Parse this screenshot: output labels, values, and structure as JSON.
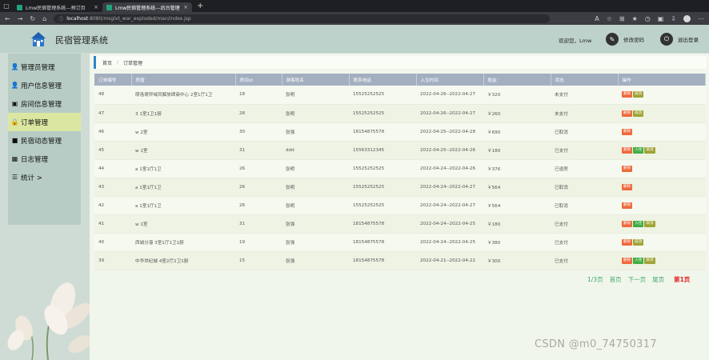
{
  "browser": {
    "tabs": [
      {
        "title": "Lmw民宿管理系统---预订页",
        "close": "×",
        "active": false
      },
      {
        "title": "Lmw民宿管理系统---后台管理",
        "close": "×",
        "active": true
      }
    ],
    "new_tab": "+",
    "url_host": "localhost",
    "url_rest": ":8080/msglxt_war_exploded/man/index.jsp"
  },
  "header": {
    "app_title": "民宿管理系统",
    "welcome": "欢迎您，Lmw",
    "change_password": "修改密码",
    "logout": "退出登录"
  },
  "sidebar": {
    "items": [
      {
        "label": "管理员管理",
        "icon": "👤"
      },
      {
        "label": "用户信息管理",
        "icon": "👤"
      },
      {
        "label": "房间信息管理",
        "icon": "▣"
      },
      {
        "label": "订单管理",
        "icon": "🔒",
        "active": true
      },
      {
        "label": "民宿动态管理",
        "icon": "■"
      },
      {
        "label": "日志管理",
        "icon": "▦"
      },
      {
        "label": "统计 >",
        "icon": "☰"
      }
    ]
  },
  "breadcrumb": {
    "home": "首页",
    "sep": "/",
    "current": "订单管理"
  },
  "table": {
    "columns": [
      "订单编号",
      "房屋",
      "房间id",
      "游客姓名",
      "联系电话",
      "入住时间",
      "租金",
      "状态",
      "操作"
    ],
    "rows": [
      {
        "id": "48",
        "room": "摩洛哥异域风解放碑商中心 2室1厅1卫",
        "room_id": "18",
        "guest": "张明",
        "phone": "15525252525",
        "dates": "2022-04-26--2022-04-27",
        "rent": "￥320",
        "status": "未支付",
        "actions": [
          "删除",
          "取消"
        ]
      },
      {
        "id": "47",
        "room": "3 1室1卫1厨",
        "room_id": "28",
        "guest": "张明",
        "phone": "15525252525",
        "dates": "2022-04-26--2022-04-27",
        "rent": "￥260",
        "status": "未支付",
        "actions": [
          "删除",
          "取消"
        ]
      },
      {
        "id": "46",
        "room": "w 2室",
        "room_id": "30",
        "guest": "张强",
        "phone": "18154875578",
        "dates": "2022-04-25--2022-04-28",
        "rent": "￥690",
        "status": "已取消",
        "actions": [
          "删除"
        ]
      },
      {
        "id": "45",
        "room": "w 1室",
        "room_id": "31",
        "guest": "ddd",
        "phone": "15563312345",
        "dates": "2022-04-25--2022-04-26",
        "rent": "￥180",
        "status": "已支付",
        "actions": [
          "删除",
          "入住",
          "取消"
        ]
      },
      {
        "id": "44",
        "room": "a 1室1厅1卫",
        "room_id": "26",
        "guest": "张明",
        "phone": "15525252525",
        "dates": "2022-04-24--2022-04-26",
        "rent": "￥376",
        "status": "已退房",
        "actions": [
          "删除"
        ]
      },
      {
        "id": "43",
        "room": "a 1室1厅1卫",
        "room_id": "26",
        "guest": "张明",
        "phone": "15525252525",
        "dates": "2022-04-24--2022-04-27",
        "rent": "￥564",
        "status": "已取消",
        "actions": [
          "删除"
        ]
      },
      {
        "id": "42",
        "room": "a 1室1厅1卫",
        "room_id": "26",
        "guest": "张明",
        "phone": "15525252525",
        "dates": "2022-04-24--2022-04-27",
        "rent": "￥564",
        "status": "已取消",
        "actions": [
          "删除"
        ]
      },
      {
        "id": "41",
        "room": "w 1室",
        "room_id": "31",
        "guest": "张强",
        "phone": "18154875578",
        "dates": "2022-04-24--2022-04-25",
        "rent": "￥180",
        "status": "已支付",
        "actions": [
          "删除",
          "入住",
          "取消"
        ]
      },
      {
        "id": "40",
        "room": "西城分港 3室1厅1卫1厨",
        "room_id": "19",
        "guest": "张强",
        "phone": "18154875578",
        "dates": "2022-04-24--2022-04-25",
        "rent": "￥380",
        "status": "已支付",
        "actions": [
          "删除",
          "取消"
        ]
      },
      {
        "id": "39",
        "room": "中华世纪城 4室2厅2卫1厨",
        "room_id": "15",
        "guest": "张强",
        "phone": "18154875578",
        "dates": "2022-04-21--2022-04-22",
        "rent": "￥300",
        "status": "已支付",
        "actions": [
          "删除",
          "入住",
          "取消"
        ]
      }
    ]
  },
  "pager": {
    "count": "1/3页",
    "first": "首页",
    "next": "下一页",
    "last": "尾页",
    "current": "第1页"
  },
  "watermark": "CSDN @m0_74750317",
  "colors": {
    "accent": "#2d86c9",
    "delete": "#ee6a3c",
    "cancel": "#a0a436",
    "checkin": "#41ad43",
    "pager": "#3ea86b",
    "current_page": "#e02020"
  }
}
